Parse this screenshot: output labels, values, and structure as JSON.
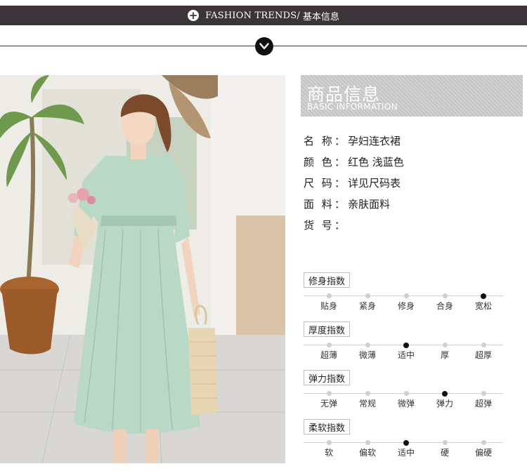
{
  "header": {
    "brand": "FASHION TRENDS/",
    "section": "基本信息"
  },
  "photo": {
    "description": "Model in mint-green square-neck maternity dress holding flowers and a straw bag"
  },
  "info": {
    "title_cn": "商品信息",
    "title_en": "BASIC INFORMATION",
    "fields": [
      {
        "key": "名 称",
        "value": "孕妇连衣裙"
      },
      {
        "key": "颜 色",
        "value": "红色 浅蓝色"
      },
      {
        "key": "尺 码",
        "value": "详见尺码表"
      },
      {
        "key": "面 料",
        "value": "亲肤面料"
      },
      {
        "key": "货 号",
        "value": ""
      }
    ]
  },
  "indices": [
    {
      "label": "修身指数",
      "options": [
        "贴身",
        "紧身",
        "修身",
        "合身",
        "宽松"
      ],
      "selected": 4
    },
    {
      "label": "厚度指数",
      "options": [
        "超薄",
        "微薄",
        "适中",
        "厚",
        "超厚"
      ],
      "selected": 2
    },
    {
      "label": "弹力指数",
      "options": [
        "无弹",
        "常规",
        "微弹",
        "弹力",
        "超弹"
      ],
      "selected": 3
    },
    {
      "label": "柔软指数",
      "options": [
        "软",
        "偏软",
        "适中",
        "硬",
        "偏硬"
      ],
      "selected": 2
    }
  ],
  "colors": {
    "bar": "#3b3539",
    "dress": "#b9d8c6",
    "active_dot": "#111111",
    "inactive_dot": "#cfcfcf"
  }
}
